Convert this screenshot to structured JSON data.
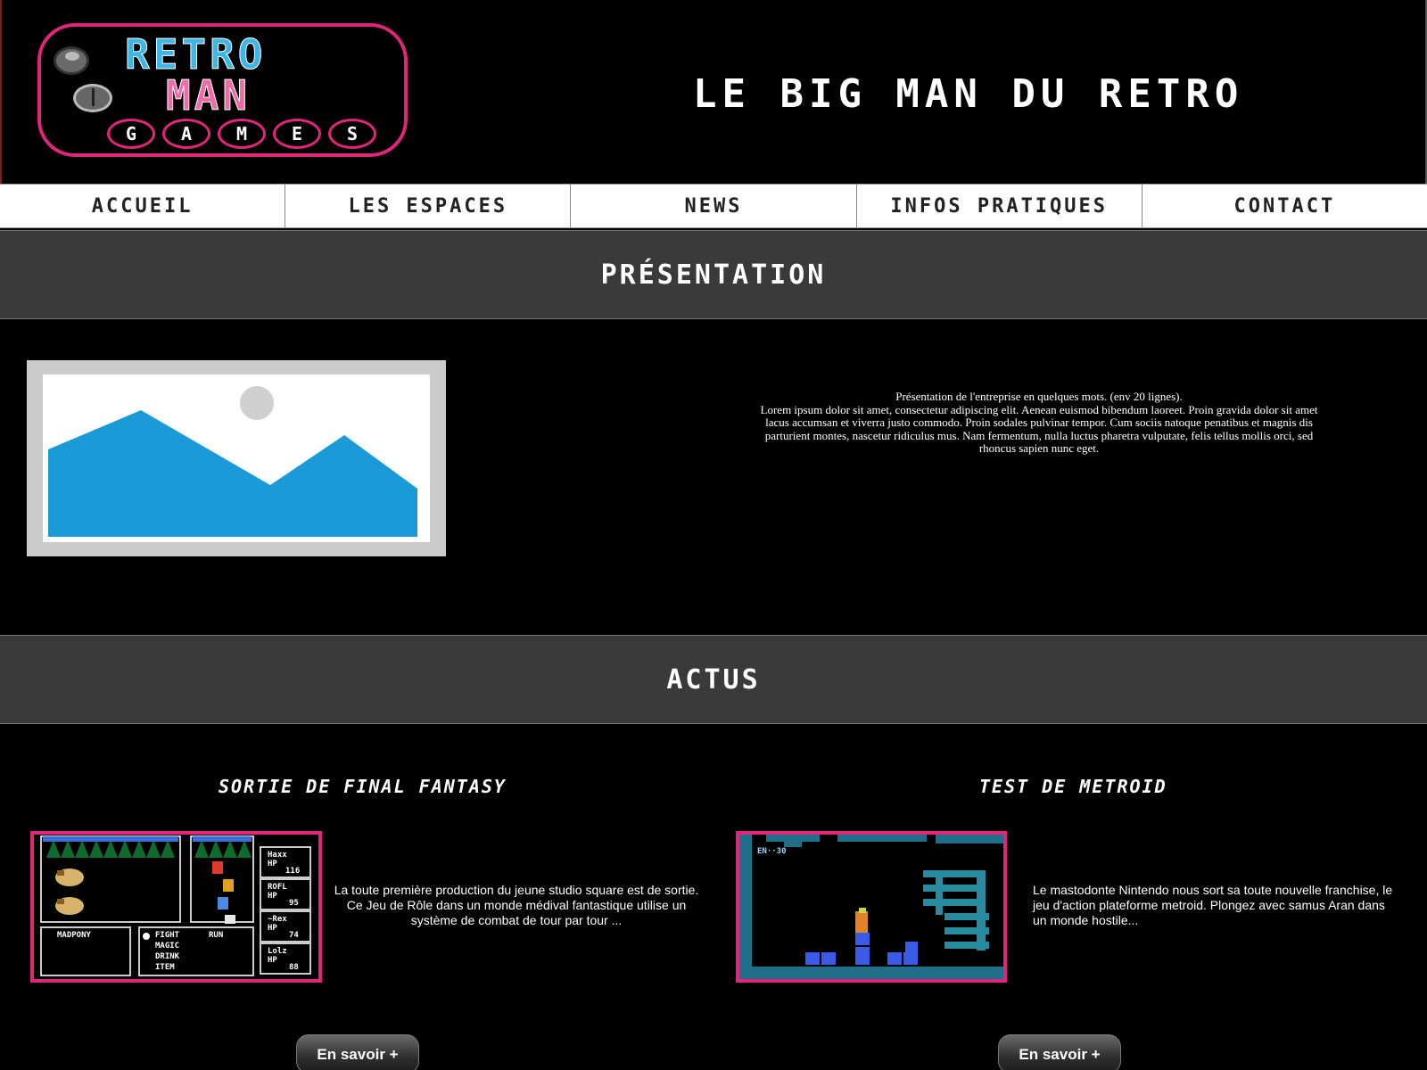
{
  "header": {
    "logo": {
      "line1": "RETRO",
      "line2": "MAN",
      "letters": [
        "G",
        "A",
        "M",
        "E",
        "S"
      ]
    },
    "tagline": "LE BIG MAN DU RETRO"
  },
  "nav": {
    "items": [
      {
        "label": "ACCUEIL"
      },
      {
        "label": "LES ESPACES"
      },
      {
        "label": "NEWS"
      },
      {
        "label": "INFOS PRATIQUES"
      },
      {
        "label": "CONTACT"
      }
    ]
  },
  "presentation": {
    "heading": "PRÉSENTATION",
    "intro": "Présentation de l'entreprise en quelques mots. (env 20 lignes).",
    "body": "Lorem ipsum dolor sit amet, consectetur adipiscing elit. Aenean euismod bibendum laoreet. Proin gravida dolor sit amet lacus accumsan et viverra justo commodo. Proin sodales pulvinar tempor. Cum sociis natoque penatibus et magnis dis parturient montes, nascetur ridiculus mus. Nam fermentum, nulla luctus pharetra vulputate, felis tellus mollis orci, sed rhoncus sapien nunc eget."
  },
  "actus": {
    "heading": "ACTUS",
    "news": [
      {
        "title": "SORTIE DE FINAL FANTASY",
        "description": "La toute première production du jeune studio square est de sortie. Ce Jeu de Rôle dans un monde médival fantastique utilise un système de combat de tour par tour ...",
        "button": "En savoir +",
        "screen": {
          "enemy": "MADPONY",
          "menu": [
            "FIGHT",
            "RUN",
            "MAGIC",
            "DRINK",
            "ITEM"
          ],
          "party": [
            {
              "name": "Haxx",
              "hp": "116"
            },
            {
              "name": "ROFL",
              "hp": "95"
            },
            {
              "name": "~Rex",
              "hp": "74"
            },
            {
              "name": "Lolz",
              "hp": "88"
            }
          ],
          "hp_label": "HP"
        }
      },
      {
        "title": "TEST DE METROID",
        "description": "Le mastodonte Nintendo nous sort sa toute nouvelle franchise, le jeu d'action plateforme metroid. Plongez avec samus Aran dans un monde hostile...",
        "button": "En savoir +",
        "screen": {
          "energy": "EN··30"
        }
      }
    ]
  },
  "colors": {
    "accent_pink": "#e0267a",
    "logo_blue": "#3bb6e8",
    "band_gray": "#3a3a3a",
    "mountain_blue": "#1a9ad6"
  }
}
